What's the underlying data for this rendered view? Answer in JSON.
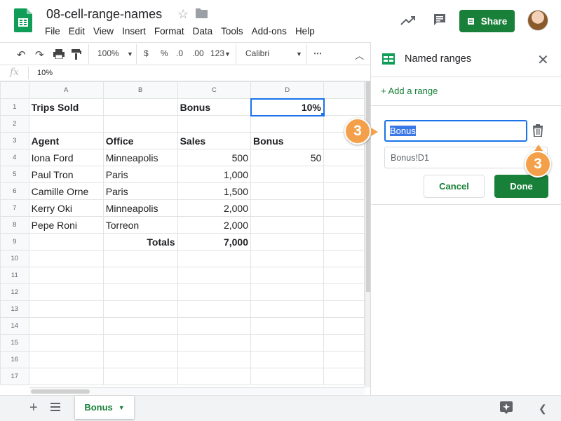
{
  "app": {
    "title": "08-cell-range-names",
    "menu": [
      "File",
      "Edit",
      "View",
      "Insert",
      "Format",
      "Data",
      "Tools",
      "Add-ons",
      "Help"
    ],
    "share_label": "Share"
  },
  "toolbar": {
    "zoom": "100%",
    "currency": "$",
    "percent": "%",
    "decrease_decimal": ".0",
    "increase_decimal": ".00",
    "more_formats": "123",
    "font": "Calibri",
    "more": "⋯"
  },
  "formula_bar": {
    "fx": "fx",
    "value": "10%"
  },
  "sheet": {
    "columns": [
      "A",
      "B",
      "C",
      "D"
    ],
    "rows": [
      {
        "n": "1",
        "cells": [
          "Trips Sold",
          "",
          "Bonus",
          "10%"
        ]
      },
      {
        "n": "2",
        "cells": [
          "",
          "",
          "",
          ""
        ]
      },
      {
        "n": "3",
        "cells": [
          "Agent",
          "Office",
          "Sales",
          "Bonus"
        ]
      },
      {
        "n": "4",
        "cells": [
          "Iona Ford",
          "Minneapolis",
          "500",
          "50"
        ]
      },
      {
        "n": "5",
        "cells": [
          "Paul Tron",
          "Paris",
          "1,000",
          ""
        ]
      },
      {
        "n": "6",
        "cells": [
          "Camille Orne",
          "Paris",
          "1,500",
          ""
        ]
      },
      {
        "n": "7",
        "cells": [
          "Kerry Oki",
          "Minneapolis",
          "2,000",
          ""
        ]
      },
      {
        "n": "8",
        "cells": [
          "Pepe Roni",
          "Torreon",
          "2,000",
          ""
        ]
      },
      {
        "n": "9",
        "cells": [
          "",
          "Totals",
          "7,000",
          ""
        ]
      },
      {
        "n": "10",
        "cells": [
          "",
          "",
          "",
          ""
        ]
      },
      {
        "n": "11",
        "cells": [
          "",
          "",
          "",
          ""
        ]
      },
      {
        "n": "12",
        "cells": [
          "",
          "",
          "",
          ""
        ]
      },
      {
        "n": "13",
        "cells": [
          "",
          "",
          "",
          ""
        ]
      },
      {
        "n": "14",
        "cells": [
          "",
          "",
          "",
          ""
        ]
      },
      {
        "n": "15",
        "cells": [
          "",
          "",
          "",
          ""
        ]
      },
      {
        "n": "16",
        "cells": [
          "",
          "",
          "",
          ""
        ]
      },
      {
        "n": "17",
        "cells": [
          "",
          "",
          "",
          ""
        ]
      }
    ]
  },
  "sheet_tab": {
    "label": "Bonus"
  },
  "panel": {
    "title": "Named ranges",
    "add_range": "+ Add a range",
    "name_value": "Bonus",
    "range_value": "Bonus!D1",
    "cancel_label": "Cancel",
    "done_label": "Done"
  },
  "callouts": [
    "3",
    "3"
  ],
  "colors": {
    "accent_green": "#188038",
    "selection_blue": "#1a73e8",
    "callout_orange": "#f4a04a"
  }
}
